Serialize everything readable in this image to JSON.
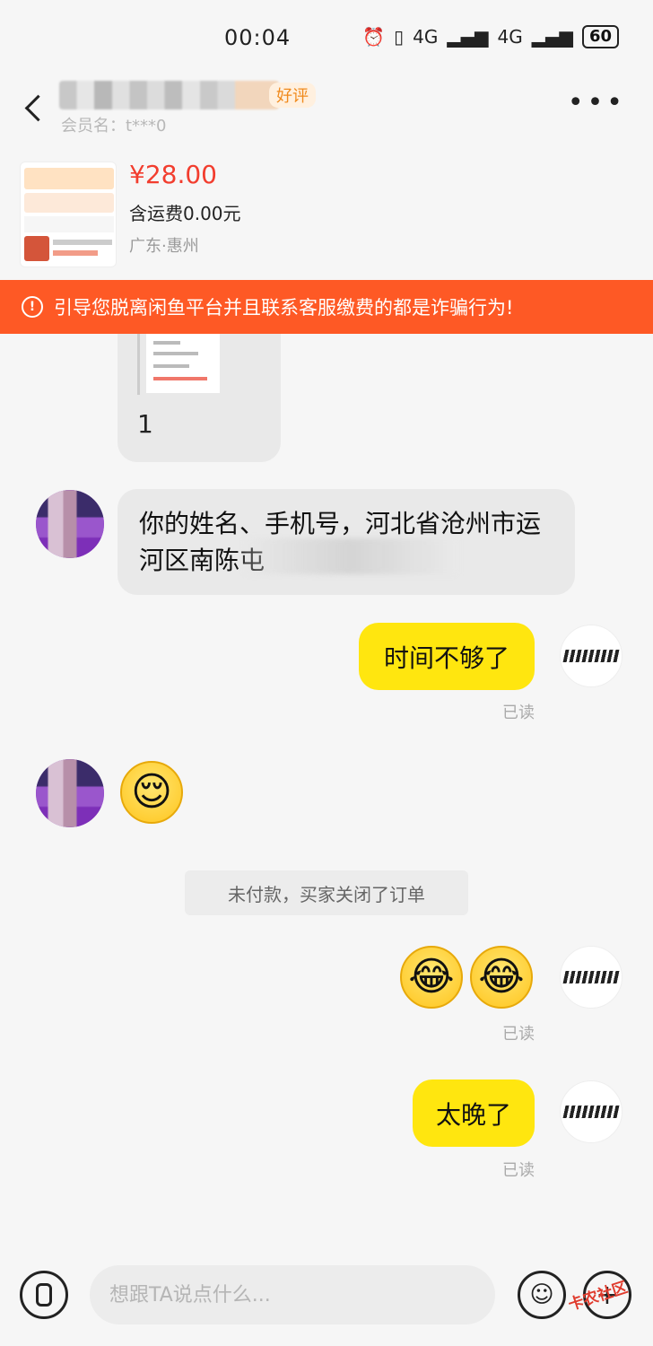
{
  "status_bar": {
    "time": "00:04",
    "network_1": "4G",
    "network_2": "4G",
    "battery": "60"
  },
  "header": {
    "nickname_tag": "好评",
    "member_label": "会员名：t***0"
  },
  "product": {
    "price": "¥28.00",
    "shipping": "含运费0.00元",
    "location": "广东·惠州"
  },
  "warning": {
    "text": "引导您脱离闲鱼平台并且联系客服缴费的都是诈骗行为!"
  },
  "messages": {
    "img_caption": "1",
    "left_text": "你的姓名、手机号，河北省沧州市运河区南陈屯",
    "right_1": "时间不够了",
    "read_1": "已读",
    "left_emoji": "😌",
    "system": "未付款，买家关闭了订单",
    "right_emojis": [
      "😂",
      "😂"
    ],
    "read_2": "已读",
    "right_2": "太晚了",
    "read_3": "已读"
  },
  "input_bar": {
    "placeholder": "想跟TA说点什么..."
  },
  "watermark": "卡农社区"
}
